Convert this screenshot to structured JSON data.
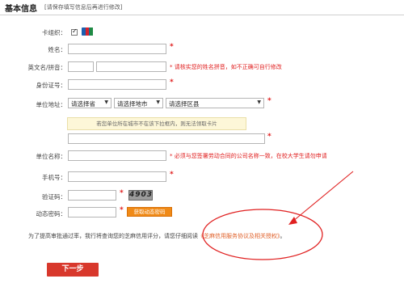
{
  "header": {
    "title": "基本信息",
    "note": "[请保存填写信息后再进行修改]"
  },
  "form": {
    "card_org_label": "卡组织：",
    "name_label": "姓名：",
    "pinyin_label": "英文名/拼音：",
    "pinyin_warning": "* 请核实您的姓名拼音，如不正确可自行修改",
    "id_label": "身份证号：",
    "address_label": "单位地址：",
    "province_select": "请选择省",
    "city_select": "请选择地市",
    "district_select": "请选择区县",
    "address_tip": "若您单位所在城市不在该下拉框内，则无法领取卡片",
    "company_label": "单位名称：",
    "company_warning": "* 必须与您签署劳动合同的公司名称一致，在校大学生请勿申请",
    "phone_label": "手机号：",
    "captcha_label": "验证码：",
    "captcha_text": "4903",
    "dynamic_label": "动态密码：",
    "get_code_label": "获取动态密码",
    "required_mark": "*"
  },
  "agreement": {
    "prefix": "为了提高审批通过率，我行将查询您的芝麻信用评分，请您仔细阅读",
    "link": "《芝麻信用服务协议及相关授权》",
    "suffix": "。"
  },
  "next_button": "下一步",
  "colors": {
    "required": "#e02020",
    "get_code_bg": "#f08a17",
    "next_button_bg": "#d8382c",
    "annotation": "#e02020"
  }
}
